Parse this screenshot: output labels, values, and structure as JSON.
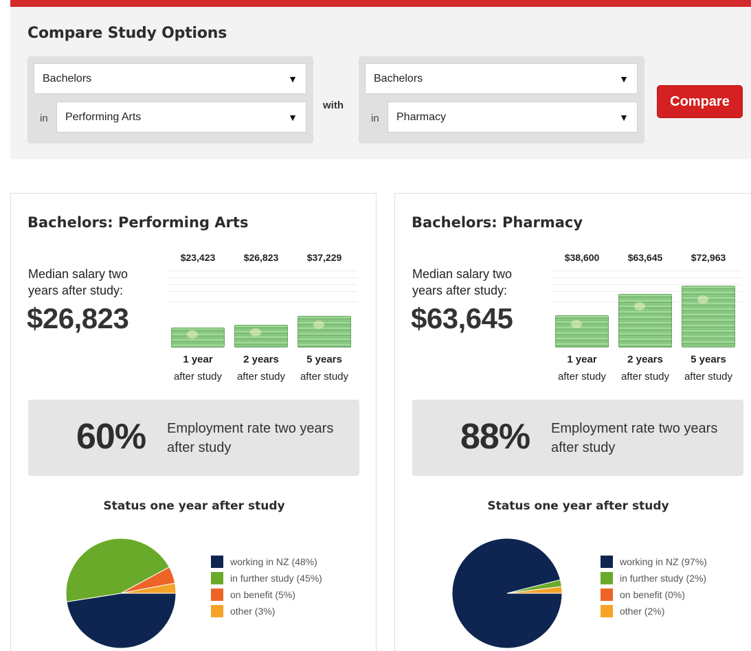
{
  "compare": {
    "title": "Compare Study Options",
    "left": {
      "level": "Bachelors",
      "in_label": "in",
      "field": "Performing Arts"
    },
    "with_label": "with",
    "right": {
      "level": "Bachelors",
      "in_label": "in",
      "field": "Pharmacy"
    },
    "button_label": "Compare",
    "arrow_glyph": "▼"
  },
  "cards": [
    {
      "title": "Bachelors: Performing Arts",
      "median_label": "Median salary two years after study:",
      "median_value": "$26,823",
      "salaries": [
        {
          "value_label": "$23,423",
          "value": 23423,
          "period": "1 year",
          "sub": "after study"
        },
        {
          "value_label": "$26,823",
          "value": 26823,
          "period": "2 years",
          "sub": "after study"
        },
        {
          "value_label": "$37,229",
          "value": 37229,
          "period": "5 years",
          "sub": "after study"
        }
      ],
      "employment_pct": "60%",
      "employment_label": "Employment rate two years after study",
      "status_title": "Status one year after study",
      "legend": [
        {
          "label": "working in NZ (48%)",
          "color": "#0d2550"
        },
        {
          "label": "in further study (45%)",
          "color": "#6aaa2a"
        },
        {
          "label": "on benefit (5%)",
          "color": "#ee6426"
        },
        {
          "label": "other (3%)",
          "color": "#f5a428"
        }
      ]
    },
    {
      "title": "Bachelors: Pharmacy",
      "median_label": "Median salary two years after study:",
      "median_value": "$63,645",
      "salaries": [
        {
          "value_label": "$38,600",
          "value": 38600,
          "period": "1 year",
          "sub": "after study"
        },
        {
          "value_label": "$63,645",
          "value": 63645,
          "period": "2 years",
          "sub": "after study"
        },
        {
          "value_label": "$72,963",
          "value": 72963,
          "period": "5 years",
          "sub": "after study"
        }
      ],
      "employment_pct": "88%",
      "employment_label": "Employment rate two years after study",
      "status_title": "Status one year after study",
      "legend": [
        {
          "label": "working in NZ (97%)",
          "color": "#0d2550"
        },
        {
          "label": "in further study (2%)",
          "color": "#6aaa2a"
        },
        {
          "label": "on benefit (0%)",
          "color": "#ee6426"
        },
        {
          "label": "other (2%)",
          "color": "#f5a428"
        }
      ]
    }
  ],
  "chart_data": [
    {
      "type": "bar",
      "categories": [
        "1 year after study",
        "2 years after study",
        "5 years after study"
      ],
      "values": [
        23423,
        26823,
        37229
      ],
      "ylim": [
        0,
        75000
      ]
    },
    {
      "type": "bar",
      "categories": [
        "1 year after study",
        "2 years after study",
        "5 years after study"
      ],
      "values": [
        38600,
        63645,
        72963
      ],
      "ylim": [
        0,
        75000
      ]
    },
    {
      "type": "pie",
      "title": "Status one year after study",
      "categories": [
        "working in NZ",
        "in further study",
        "on benefit",
        "other"
      ],
      "values": [
        48,
        45,
        5,
        3
      ],
      "colors": [
        "#0d2550",
        "#6aaa2a",
        "#ee6426",
        "#f5a428"
      ]
    },
    {
      "type": "pie",
      "title": "Status one year after study",
      "categories": [
        "working in NZ",
        "in further study",
        "on benefit",
        "other"
      ],
      "values": [
        97,
        2,
        0,
        2
      ],
      "colors": [
        "#0d2550",
        "#6aaa2a",
        "#ee6426",
        "#f5a428"
      ]
    }
  ]
}
